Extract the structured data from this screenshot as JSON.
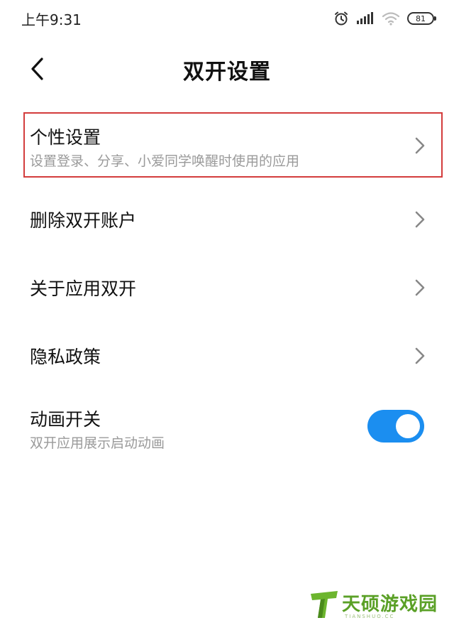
{
  "status_bar": {
    "time": "上午9:31",
    "battery": "81",
    "icons": [
      "alarm-icon",
      "signal-icon",
      "wifi-icon",
      "battery-icon"
    ]
  },
  "header": {
    "title": "双开设置",
    "back_icon": "back-arrow-icon"
  },
  "settings": {
    "personal": {
      "title": "个性设置",
      "subtitle": "设置登录、分享、小爱同学唤醒时使用的应用"
    },
    "delete_account": {
      "title": "删除双开账户"
    },
    "about": {
      "title": "关于应用双开"
    },
    "privacy": {
      "title": "隐私政策"
    },
    "animation": {
      "title": "动画开关",
      "subtitle": "双开应用展示启动动画",
      "enabled": true
    }
  },
  "colors": {
    "accent": "#1b8ef0",
    "highlight_border": "#d33c3c",
    "subtitle": "#9a9a9a",
    "watermark": "#5aa026"
  },
  "watermark": {
    "text": "天硕游戏园",
    "sub": "TIANSHUO.CC"
  }
}
